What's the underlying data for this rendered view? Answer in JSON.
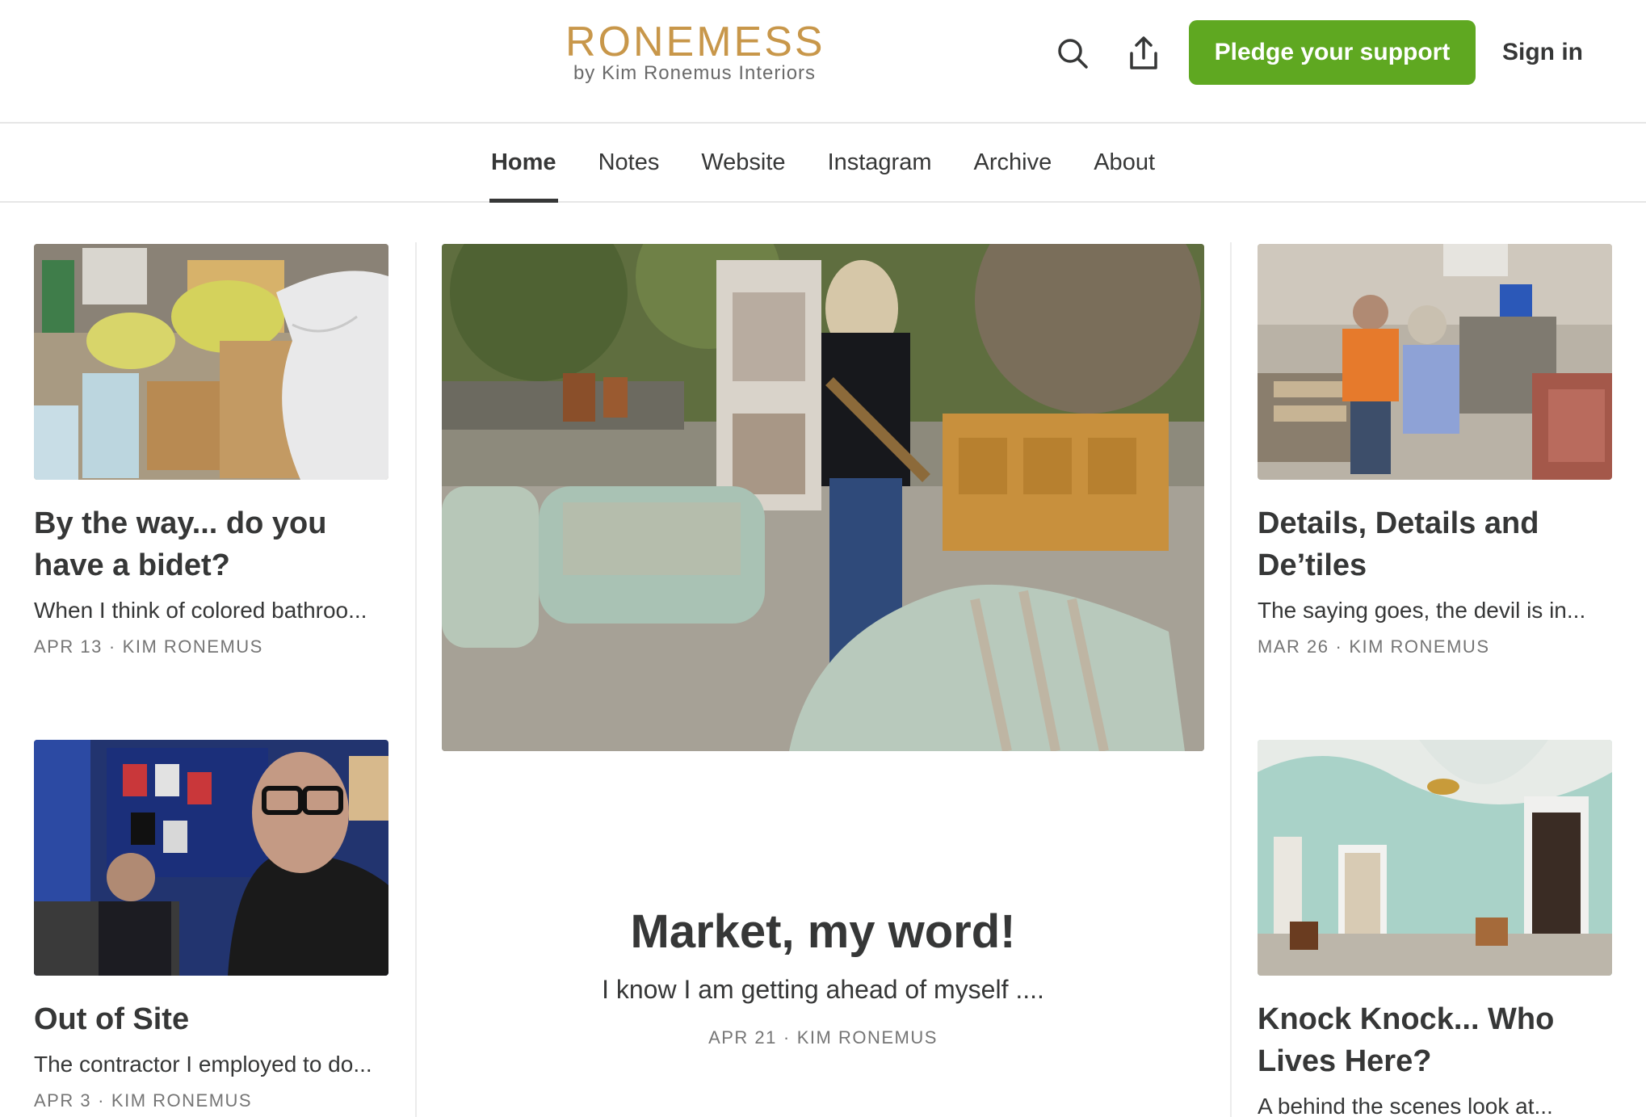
{
  "header": {
    "logo_main": "RONEMESS",
    "logo_sub": "by Kim Ronemus Interiors",
    "pledge_label": "Pledge your support",
    "signin_label": "Sign in"
  },
  "nav": {
    "items": [
      {
        "label": "Home",
        "active": true
      },
      {
        "label": "Notes"
      },
      {
        "label": "Website"
      },
      {
        "label": "Instagram"
      },
      {
        "label": "Archive"
      },
      {
        "label": "About"
      }
    ]
  },
  "posts": {
    "left": [
      {
        "title": "By the way... do you have a bidet?",
        "subtitle": "When I think of colored bathroo...",
        "date": "APR 13",
        "author": "KIM RONEMUS"
      },
      {
        "title": "Out of Site",
        "subtitle": "The contractor I employed to do...",
        "date": "APR 3",
        "author": "KIM RONEMUS"
      }
    ],
    "featured": {
      "title": "Market, my word!",
      "subtitle": "I know I am getting ahead of myself ....",
      "date": "APR 21",
      "author": "KIM RONEMUS"
    },
    "right": [
      {
        "title": "Details, Details and De’tiles",
        "subtitle": "The saying goes, the devil is in...",
        "date": "MAR 26",
        "author": "KIM RONEMUS"
      },
      {
        "title": "Knock Knock... Who Lives Here?",
        "subtitle": "A behind the scenes look at...",
        "date": "",
        "author": ""
      }
    ]
  },
  "meta_separator": "·",
  "colors": {
    "brand_gold": "#c8974a",
    "pledge_green": "#5fa821",
    "text": "#363737",
    "meta": "#757575"
  },
  "icons": {
    "search": "search-icon",
    "share": "share-icon"
  }
}
